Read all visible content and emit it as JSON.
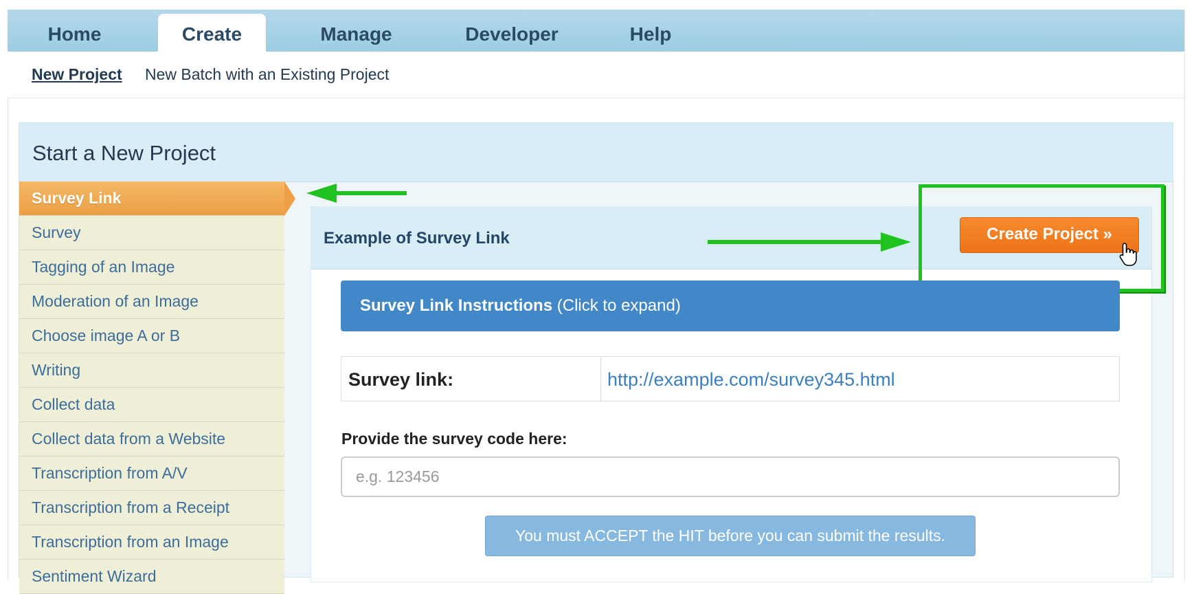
{
  "topnav": {
    "tabs": [
      {
        "label": "Home"
      },
      {
        "label": "Create",
        "active": true
      },
      {
        "label": "Manage"
      },
      {
        "label": "Developer"
      },
      {
        "label": "Help"
      }
    ]
  },
  "subnav": {
    "links": [
      {
        "label": "New Project",
        "active": true
      },
      {
        "label": "New Batch with an Existing Project"
      }
    ]
  },
  "panel": {
    "title": "Start a New Project"
  },
  "menu": {
    "items": [
      {
        "label": "Survey Link",
        "active": true
      },
      {
        "label": "Survey"
      },
      {
        "label": "Tagging of an Image"
      },
      {
        "label": "Moderation of an Image"
      },
      {
        "label": "Choose image A or B"
      },
      {
        "label": "Writing"
      },
      {
        "label": "Collect data"
      },
      {
        "label": "Collect data from a Website"
      },
      {
        "label": "Transcription from A/V"
      },
      {
        "label": "Transcription from a Receipt"
      },
      {
        "label": "Transcription from an Image"
      },
      {
        "label": "Sentiment Wizard"
      }
    ]
  },
  "example": {
    "title": "Example of Survey Link",
    "create_button": "Create Project »",
    "instructions_title": "Survey Link Instructions",
    "instructions_hint": " (Click to expand)",
    "survey_link_label": "Survey link:",
    "survey_link_url": "http://example.com/survey345.html",
    "code_label": "Provide the survey code here:",
    "code_placeholder": "e.g. 123456",
    "submit_label": "You must ACCEPT the HIT before you can submit the results."
  },
  "colors": {
    "accent_orange": "#ee7418",
    "highlight_green": "#1fc21f",
    "instruction_blue": "#4287c8"
  }
}
